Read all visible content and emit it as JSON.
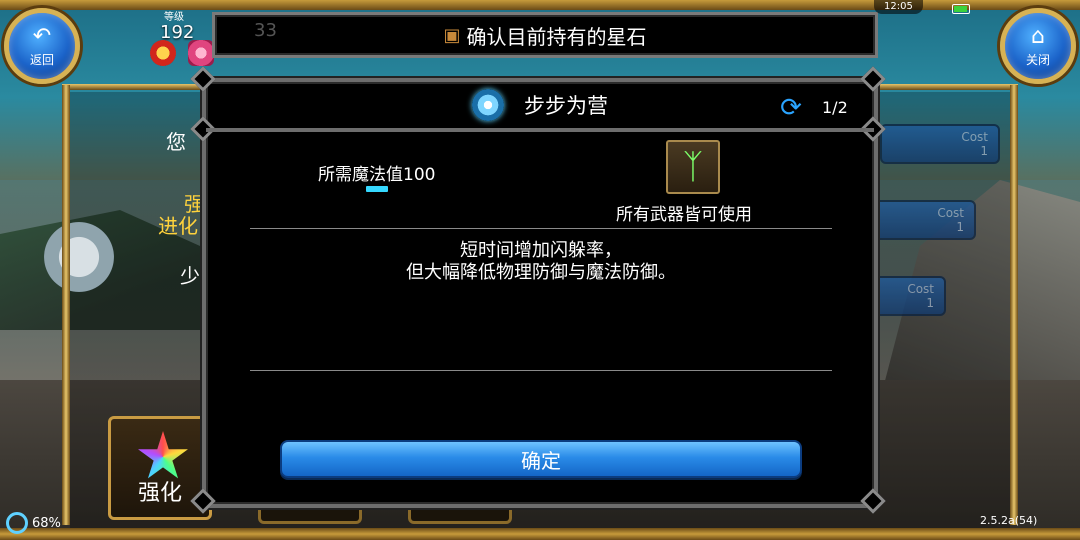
{
  "player": {
    "level_label": "等级",
    "level_value": "192",
    "ghost_count": "33"
  },
  "nav": {
    "back_label": "返回",
    "close_label": "关闭",
    "back_icon": "back-arrow-icon",
    "close_icon": "home-icon"
  },
  "title_bar": {
    "title": "确认目前持有的星石",
    "icon": "treasure-chest-icon"
  },
  "status_bar": {
    "time": "12:05",
    "battery_percent": "68%",
    "version": "2.5.2a(54)"
  },
  "background_panel": {
    "line1": "您",
    "line2": "强",
    "line3": "进化",
    "line4": "少",
    "cost_pills": [
      {
        "label": "Cost",
        "value": "1"
      },
      {
        "label": "Cost",
        "value": "1"
      },
      {
        "label": "Cost",
        "value": "1"
      }
    ],
    "enhance_label": "强化"
  },
  "modal": {
    "skill_name": "步步为营",
    "page": "1/2",
    "mp_required": "所需魔法值100",
    "weapon_restriction": "所有武器皆可使用",
    "description_line1": "短时间增加闪躲率，",
    "description_line2": "但大幅降低物理防御与魔法防御。",
    "confirm_label": "确定"
  },
  "colors": {
    "gold_frame": "#c79b3b",
    "modal_bg": "#000000",
    "confirm_blue": "#2a8be8",
    "mp_bar": "#35d8ff",
    "weapon_icon_green": "#7cff6a"
  }
}
